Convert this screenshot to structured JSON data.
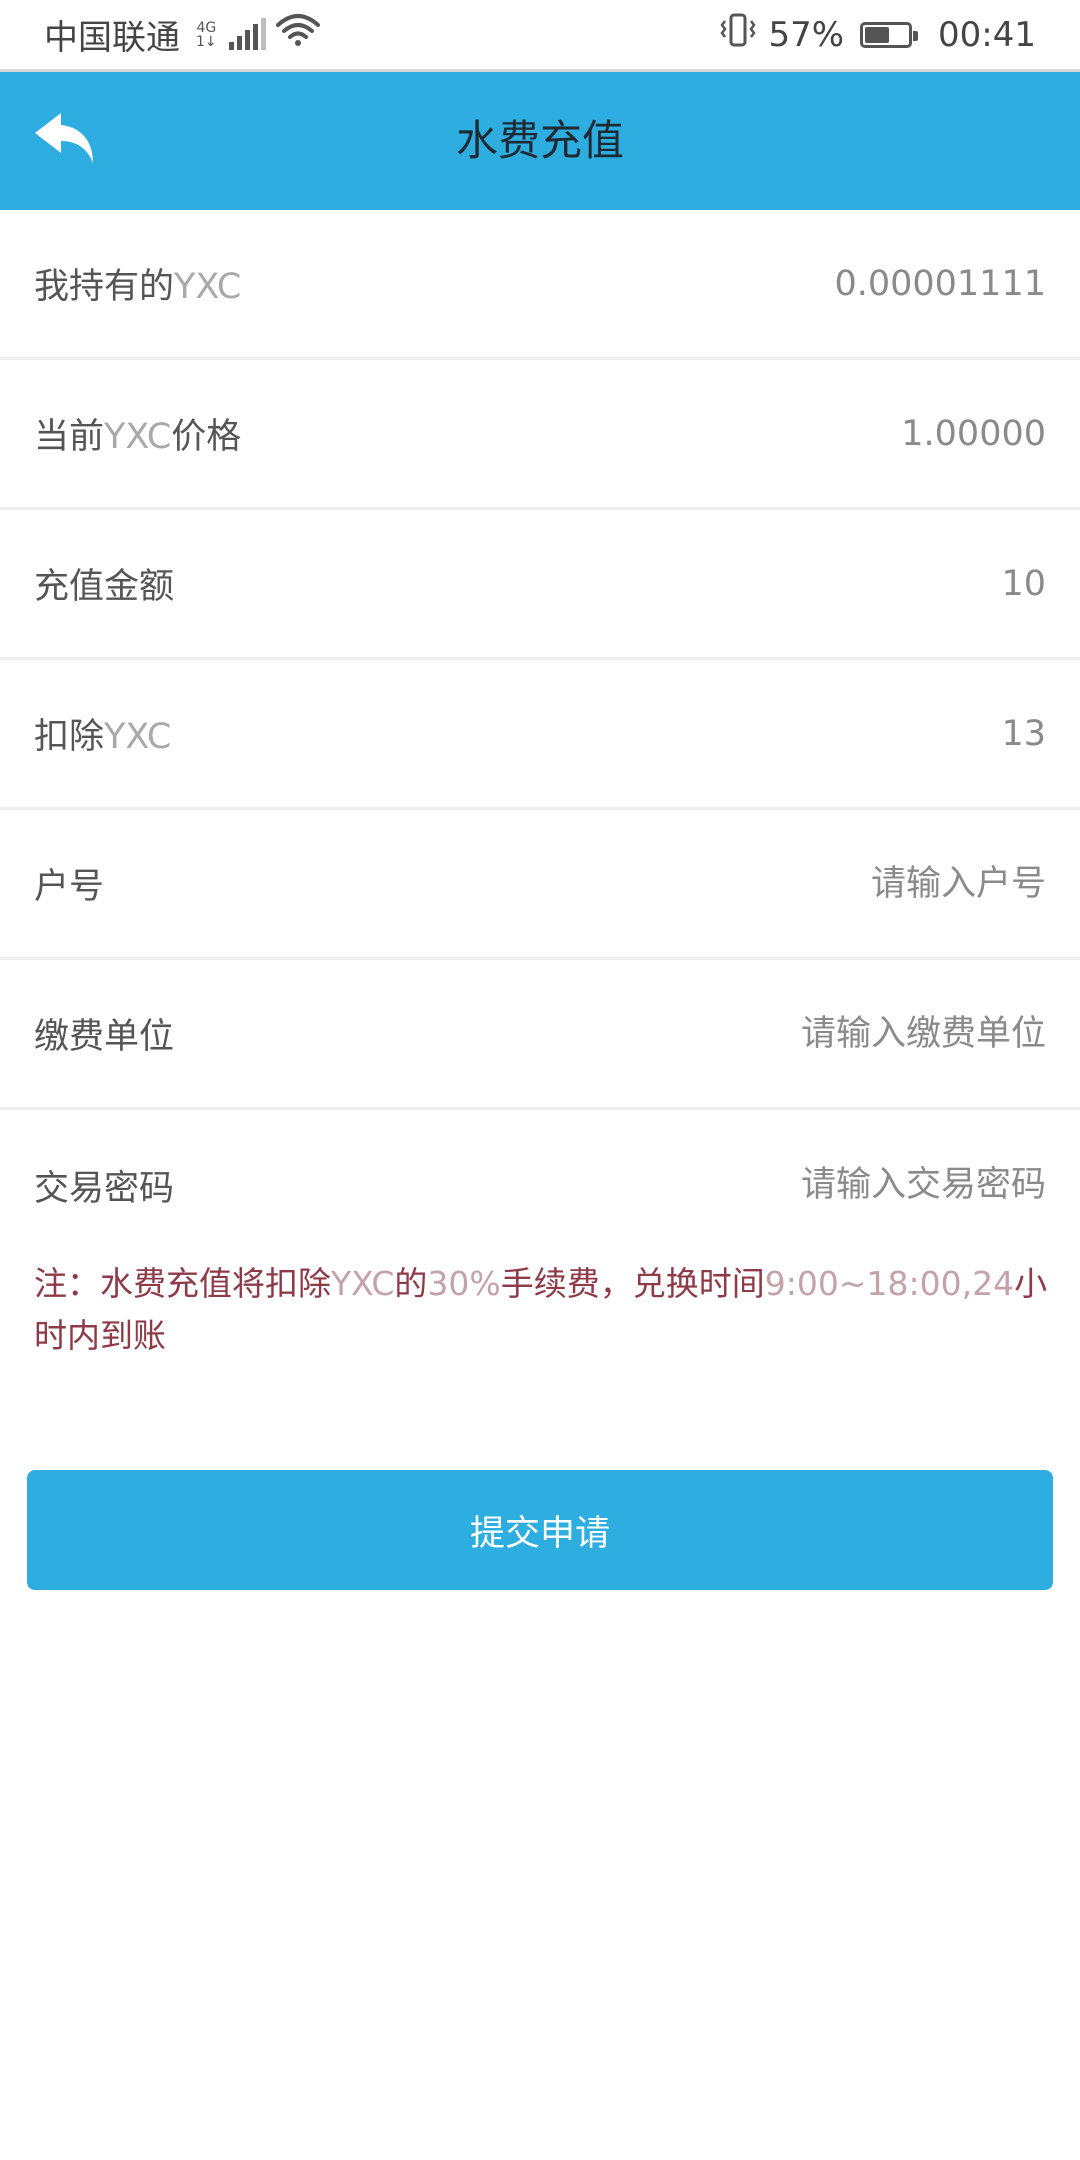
{
  "status_bar": {
    "carrier": "中国联通",
    "network": "4G",
    "network_sub": "1↓",
    "battery_percent": "57%",
    "battery_level": 0.57,
    "time": "00:41"
  },
  "header": {
    "title": "水费充值",
    "back_icon": "back-arrow-icon",
    "background_color": "#2eaee0"
  },
  "form": {
    "held_yxc": {
      "label_prefix": "我持有的",
      "label_accent": "YXC",
      "value": "0.00001111"
    },
    "yxc_price": {
      "label_prefix": "当前",
      "label_accent": "YXC",
      "label_suffix": "价格",
      "value": "1.00000"
    },
    "recharge_amount": {
      "label": "充值金额",
      "value": "10"
    },
    "deduct_yxc": {
      "label_prefix": "扣除",
      "label_accent": "YXC",
      "value": "13"
    },
    "account_number": {
      "label": "户号",
      "placeholder": "请输入户号"
    },
    "payment_unit": {
      "label": "缴费单位",
      "placeholder": "请输入缴费单位"
    },
    "trade_password": {
      "label": "交易密码",
      "placeholder": "请输入交易密码"
    }
  },
  "note": {
    "part1": " 注：水费充值将扣除",
    "part2": "YXC",
    "part3": "的",
    "part4": "30%",
    "part5": "手续费，兑换时间",
    "part6": "9:00~18:00,24",
    "part7": "小时内到账"
  },
  "submit": {
    "label": "提交申请"
  }
}
